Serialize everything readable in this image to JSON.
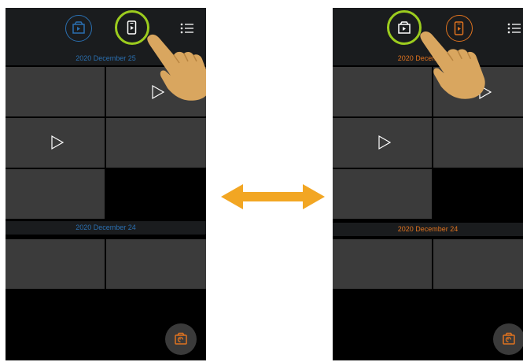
{
  "left": {
    "date_group_1": "2020 December 25",
    "date_group_2": "2020 December 24",
    "accent": "#2a6fb0"
  },
  "right": {
    "date_group_1": "2020 December 25",
    "date_group_2": "2020 December 24",
    "accent": "#e0731f"
  },
  "colors": {
    "highlight_ring": "#9ccc1e",
    "arrow": "#f2a623",
    "hand": "#d9a65f",
    "tile": "#3b3b3b",
    "bar": "#1a1c1e"
  },
  "icons": {
    "photos_tab": "photo-album-icon",
    "videos_tab": "phone-video-icon",
    "menu": "list-menu-icon",
    "fab": "camera-return-icon",
    "play": "play-icon",
    "swap": "double-arrow-icon",
    "pointer": "pointing-hand-icon"
  }
}
